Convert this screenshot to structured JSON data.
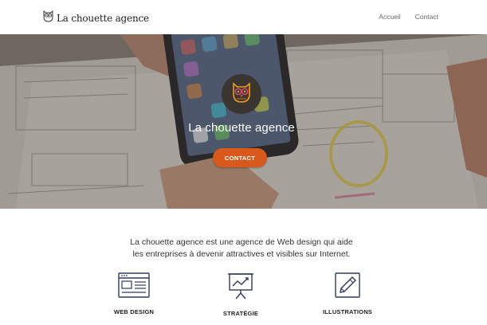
{
  "header": {
    "brand_name": "La chouette agence",
    "brand_icon": "owl-icon",
    "nav": [
      {
        "label": "Accueil"
      },
      {
        "label": "Contact"
      }
    ]
  },
  "hero": {
    "logo_icon": "owl-icon",
    "title": "La chouette agence",
    "cta_label": "CONTACT"
  },
  "intro": {
    "line1": "La chouette agence est une agence de Web design qui aide",
    "line2": "les entreprises à devenir attractives et visibles sur Internet."
  },
  "features": [
    {
      "label": "WEB DESIGN",
      "icon": "browser-window-icon"
    },
    {
      "label": "STRATÉGIE",
      "icon": "presentation-chart-icon"
    },
    {
      "label": "ILLUSTRATIONS",
      "icon": "pencil-icon"
    }
  ],
  "colors": {
    "accent": "#d9581c",
    "icon_stroke": "#2f3a5c",
    "text": "#333333"
  }
}
